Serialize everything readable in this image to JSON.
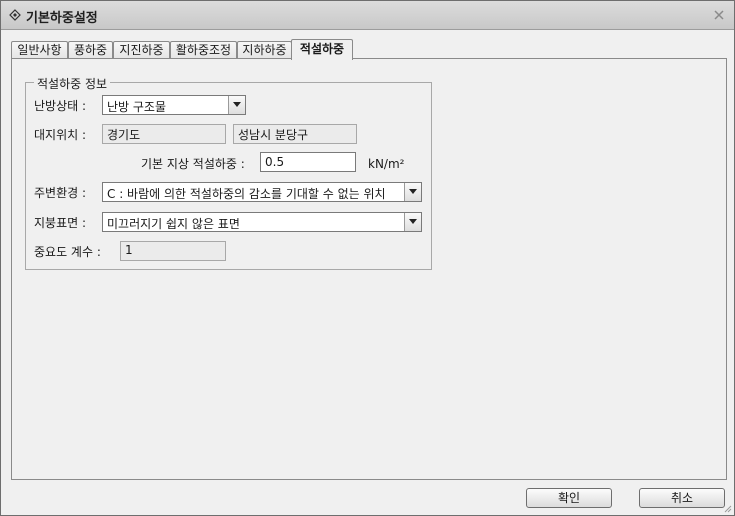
{
  "window": {
    "title": "기본하중설정",
    "icon": "diamond-icon",
    "close_icon": "close-icon"
  },
  "tabs": [
    {
      "label": "일반사항"
    },
    {
      "label": "풍하중"
    },
    {
      "label": "지진하중"
    },
    {
      "label": "활하중조정"
    },
    {
      "label": "지하하중"
    },
    {
      "label": "적설하중",
      "active": true
    }
  ],
  "snow_load_info": {
    "group_title": "적설하중 정보",
    "heating_state": {
      "label": "난방상태 :",
      "value": "난방 구조물"
    },
    "site_location": {
      "label": "대지위치 :",
      "province": "경기도",
      "city": "성남시 분당구"
    },
    "base_snow_load": {
      "label": "기본 지상 적설하중 :",
      "value": "0.5",
      "unit": "kN/m²"
    },
    "surroundings": {
      "label": "주변환경 :",
      "value": "C : 바람에 의한 적설하중의 감소를 기대할 수 없는 위치"
    },
    "roof_surface": {
      "label": "지붕표면 :",
      "value": "미끄러지기 쉽지 않은 표면"
    },
    "importance_factor": {
      "label": "중요도 계수 :",
      "value": "1"
    }
  },
  "buttons": {
    "ok": "확인",
    "cancel": "취소"
  }
}
